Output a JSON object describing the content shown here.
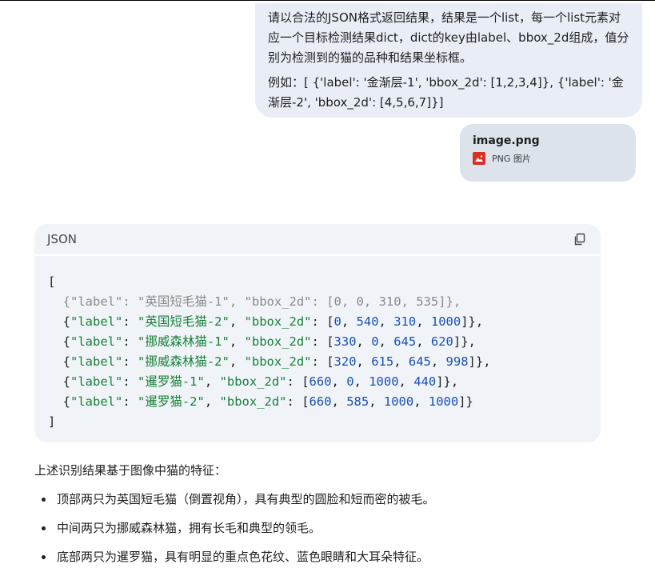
{
  "user_message": {
    "paragraph_1": "请以合法的JSON格式返回结果，结果是一个list，每一个list元素对应一个目标检测结果dict，dict的key由label、bbox_2d组成，值分别为检测到的猫的品种和结果坐标框。",
    "paragraph_2": "例如：[ {'label': '金渐层-1', 'bbox_2d': [1,2,3,4]}, {'label': '金渐层-2', 'bbox_2d': [4,5,6,7]}]"
  },
  "attachment": {
    "file_name": "image.png",
    "file_type": "PNG 图片",
    "icon": "image-file-icon"
  },
  "code_block": {
    "language": "JSON",
    "copy_icon": "copy-icon",
    "open_bracket": "[",
    "close_bracket": "]",
    "items": [
      {
        "label": "英国短毛猫-1",
        "bbox": [
          "0",
          "0",
          "310",
          "535"
        ]
      },
      {
        "label": "英国短毛猫-2",
        "bbox": [
          "0",
          "540",
          "310",
          "1000"
        ]
      },
      {
        "label": "挪威森林猫-1",
        "bbox": [
          "330",
          "0",
          "645",
          "620"
        ]
      },
      {
        "label": "挪威森林猫-2",
        "bbox": [
          "320",
          "615",
          "645",
          "998"
        ]
      },
      {
        "label": "暹罗猫-1",
        "bbox": [
          "660",
          "0",
          "1000",
          "440"
        ]
      },
      {
        "label": "暹罗猫-2",
        "bbox": [
          "660",
          "585",
          "1000",
          "1000"
        ]
      }
    ]
  },
  "answer": {
    "intro": "上述识别结果基于图像中猫的特征：",
    "bullets": [
      "顶部两只为英国短毛猫（倒置视角），具有典型的圆脸和短而密的被毛。",
      "中间两只为挪威森林猫，拥有长毛和典型的领毛。",
      "底部两只为暹罗猫，具有明显的重点色花纹、蓝色眼睛和大耳朵特征。"
    ]
  },
  "colors": {
    "user_bubble_bg": "#e9eef6",
    "code_bg": "#f0f4f9",
    "string": "#188038",
    "number": "#1a4fb3"
  }
}
